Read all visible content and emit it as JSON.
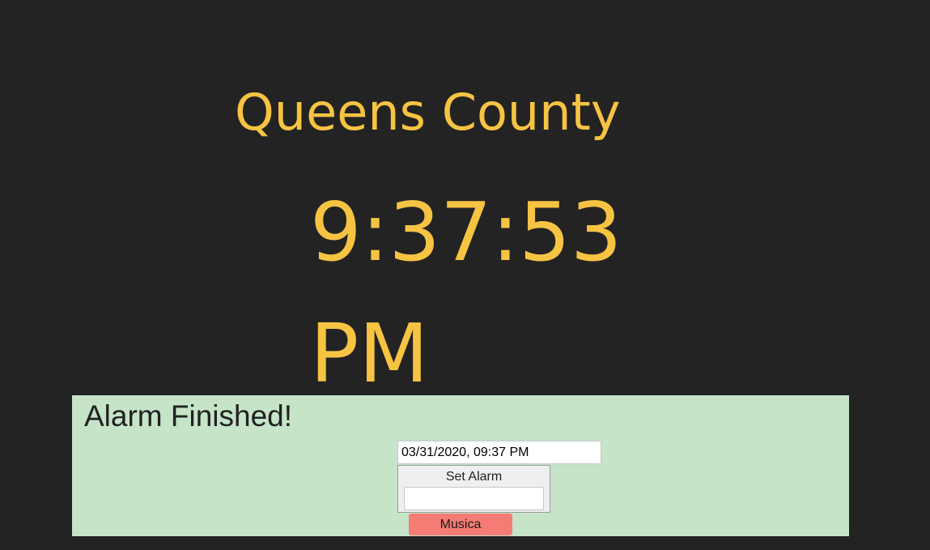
{
  "clock": {
    "location": "Queens County",
    "time": "9:37:53 PM"
  },
  "alarm": {
    "status": "Alarm Finished!",
    "datetime_value": "03/31/2020, 09:37 PM",
    "set_alarm_label": "Set Alarm",
    "music_button_label": "Musica"
  },
  "colors": {
    "background": "#232323",
    "clock_text": "#f6c343",
    "panel": "#c5e4c8",
    "music_button": "#f47c74"
  }
}
